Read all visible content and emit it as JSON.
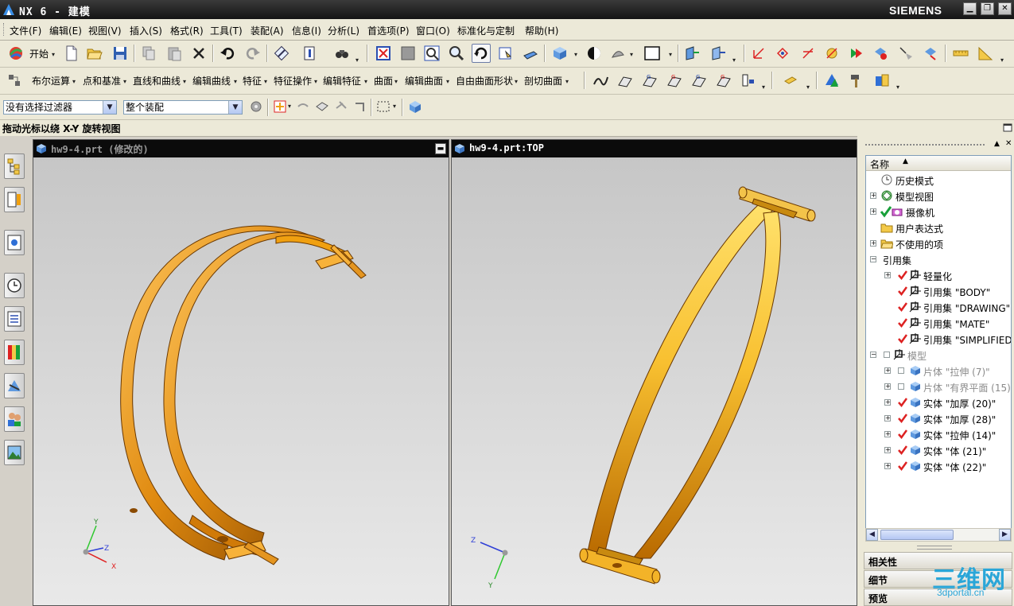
{
  "window": {
    "title": "NX 6 - 建模",
    "brand": "SIEMENS"
  },
  "menu": [
    "文件(F)",
    "编辑(E)",
    "视图(V)",
    "插入(S)",
    "格式(R)",
    "工具(T)",
    "装配(A)",
    "信息(I)",
    "分析(L)",
    "首选项(P)",
    "窗口(O)",
    "标准化与定制",
    "帮助(H)"
  ],
  "toolbar1": {
    "start_label": "开始"
  },
  "toolbar2": [
    "布尔运算",
    "点和基准",
    "直线和曲线",
    "编辑曲线",
    "特征",
    "特征操作",
    "编辑特征",
    "曲面",
    "编辑曲面",
    "自由曲面形状",
    "剖切曲面"
  ],
  "toolbar3": {
    "filter_value": "没有选择过滤器",
    "scope_value": "整个装配"
  },
  "cue": "拖动光标以绕 X-Y 旋转视图",
  "viewports": {
    "left": {
      "title": "hw9-4.prt  (修改的)"
    },
    "right": {
      "title": "hw9-4.prt:TOP"
    }
  },
  "triad": {
    "x": "X",
    "y": "Y",
    "z": "Z"
  },
  "navigator": {
    "column": "名称",
    "rows": [
      {
        "text": "历史模式"
      },
      {
        "text": "模型视图"
      },
      {
        "text": "摄像机"
      },
      {
        "text": "用户表达式"
      },
      {
        "text": "不使用的项"
      },
      {
        "text": "引用集"
      },
      {
        "text": "轻量化"
      },
      {
        "text": "引用集 \"BODY\""
      },
      {
        "text": "引用集 \"DRAWING\""
      },
      {
        "text": "引用集 \"MATE\""
      },
      {
        "text": "引用集 \"SIMPLIFIED\""
      },
      {
        "text": "模型"
      },
      {
        "text": "片体 \"拉伸 (7)\""
      },
      {
        "text": "片体 \"有界平面 (15)\""
      },
      {
        "text": "实体 \"加厚 (20)\""
      },
      {
        "text": "实体 \"加厚 (28)\""
      },
      {
        "text": "实体 \"拉伸 (14)\""
      },
      {
        "text": "实体 \"体 (21)\""
      },
      {
        "text": "实体 \"体 (22)\""
      }
    ]
  },
  "panels": [
    "相关性",
    "细节",
    "预览"
  ],
  "watermark": {
    "big": "三维网",
    "small": "3dportal.cn"
  },
  "colors": {
    "part_orange": "#f0a010",
    "titlebar": "#1a1a1a",
    "navigator_bg": "#ece9d8"
  }
}
